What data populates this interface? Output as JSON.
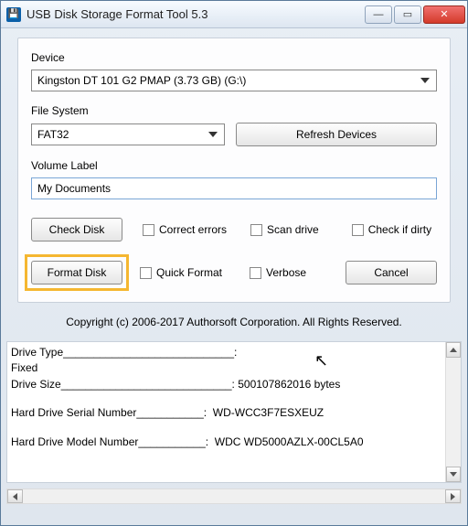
{
  "window": {
    "title": "USB Disk Storage Format Tool 5.3"
  },
  "labels": {
    "device": "Device",
    "filesystem": "File System",
    "volume": "Volume Label"
  },
  "device": {
    "selected": "Kingston  DT 101 G2  PMAP (3.73 GB) (G:\\)"
  },
  "filesystem": {
    "selected": "FAT32"
  },
  "volume": {
    "value": "My Documents"
  },
  "buttons": {
    "refresh": "Refresh Devices",
    "check": "Check Disk",
    "format": "Format Disk",
    "cancel": "Cancel"
  },
  "checks": {
    "correct": "Correct errors",
    "scan": "Scan drive",
    "dirty": "Check if dirty",
    "quick": "Quick Format",
    "verbose": "Verbose"
  },
  "copyright": "Copyright (c) 2006-2017 Authorsoft Corporation. All Rights Reserved.",
  "info": {
    "l1a": "Drive Type",
    "l1b": "____________________________:",
    "l2": "Fixed",
    "l3a": "Drive Size",
    "l3b": "____________________________: 500107862016 bytes",
    "l4a": "Hard Drive Serial Number",
    "l4b": "___________:  WD-WCC3F7ESXEUZ",
    "l5a": "Hard Drive Model Number",
    "l5b": "___________:  WDC WD5000AZLX-00CL5A0"
  }
}
